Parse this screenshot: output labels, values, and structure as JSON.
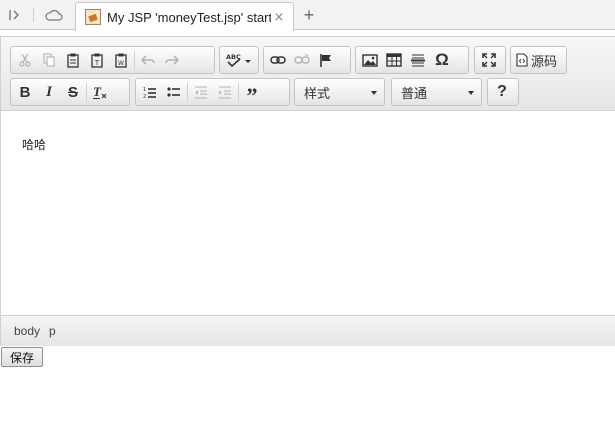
{
  "browser": {
    "tab": {
      "title": "My JSP 'moneyTest.jsp' starti",
      "close_glyph": "×"
    },
    "new_tab_glyph": "+"
  },
  "toolbar": {
    "row1": {
      "source_label": "源码"
    },
    "row2": {
      "style_combo": {
        "selected": "样式"
      },
      "format_combo": {
        "selected": "普通"
      },
      "help_glyph": "?"
    }
  },
  "content": {
    "text": "哈哈"
  },
  "elements_path": [
    "body",
    "p"
  ],
  "form": {
    "save_label": "保存"
  }
}
